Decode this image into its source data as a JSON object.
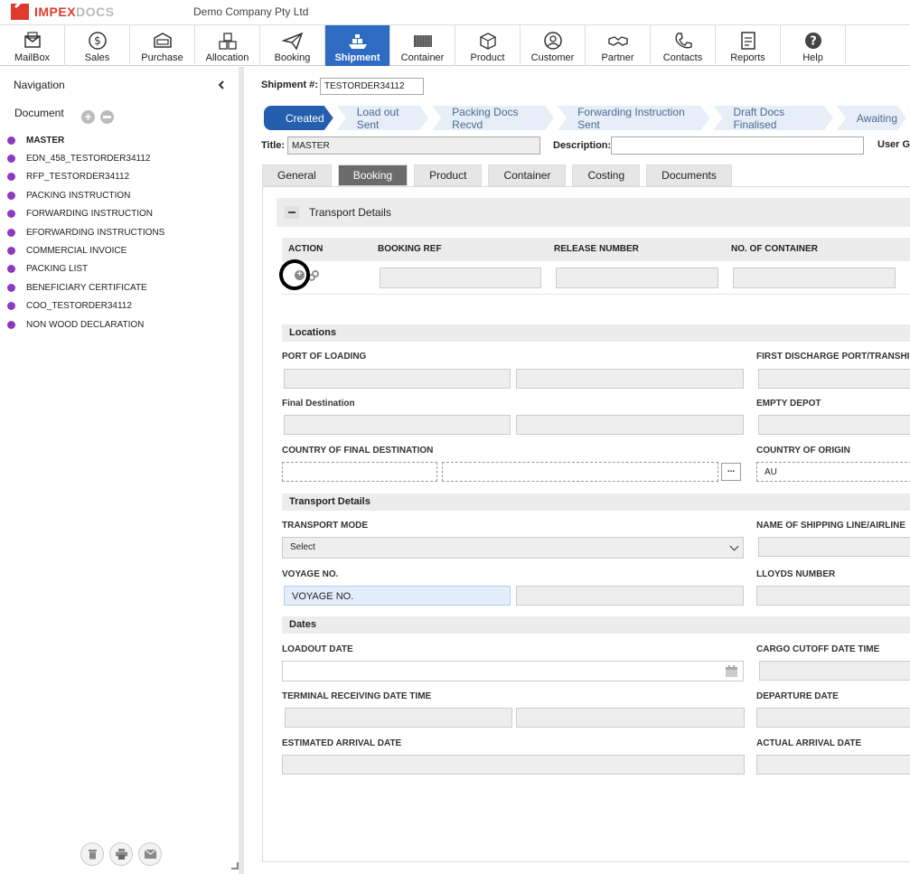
{
  "brand": {
    "part1": "IMPEX",
    "part2": "DOCS"
  },
  "company": "Demo Company Pty Ltd",
  "toolbar": [
    {
      "label": "MailBox",
      "icon": "mailbox-icon"
    },
    {
      "label": "Sales",
      "icon": "dollar-icon"
    },
    {
      "label": "Purchase",
      "icon": "cart-icon"
    },
    {
      "label": "Allocation",
      "icon": "boxes-icon"
    },
    {
      "label": "Booking",
      "icon": "paper-plane-icon"
    },
    {
      "label": "Shipment",
      "icon": "ship-icon",
      "active": true
    },
    {
      "label": "Container",
      "icon": "container-icon"
    },
    {
      "label": "Product",
      "icon": "package-icon"
    },
    {
      "label": "Customer",
      "icon": "user-icon"
    },
    {
      "label": "Partner",
      "icon": "handshake-icon"
    },
    {
      "label": "Contacts",
      "icon": "phone-icon"
    },
    {
      "label": "Reports",
      "icon": "report-icon"
    },
    {
      "label": "Help",
      "icon": "help-icon"
    }
  ],
  "sidebar": {
    "nav_title": "Navigation",
    "doc_title": "Document",
    "documents": [
      {
        "label": "MASTER",
        "bold": true
      },
      {
        "label": "EDN_458_TESTORDER34112"
      },
      {
        "label": "RFP_TESTORDER34112"
      },
      {
        "label": "PACKING INSTRUCTION"
      },
      {
        "label": "FORWARDING INSTRUCTION"
      },
      {
        "label": "EFORWARDING INSTRUCTIONS"
      },
      {
        "label": "COMMERCIAL INVOICE"
      },
      {
        "label": "PACKING LIST"
      },
      {
        "label": "BENEFICIARY CERTIFICATE"
      },
      {
        "label": "COO_TESTORDER34112"
      },
      {
        "label": "NON WOOD DECLARATION"
      }
    ]
  },
  "shipment": {
    "label": "Shipment #:",
    "value": "TESTORDER34112"
  },
  "steps": [
    {
      "label": "Created",
      "active": true
    },
    {
      "label": "Load out Sent"
    },
    {
      "label": "Packing Docs Recvd"
    },
    {
      "label": "Forwarding Instruction Sent"
    },
    {
      "label": "Draft Docs Finalised"
    },
    {
      "label": "Awaiting"
    }
  ],
  "header": {
    "title_label": "Title:",
    "title_value": "MASTER",
    "description_label": "Description:",
    "user_group_label": "User Gr"
  },
  "tabs": [
    {
      "label": "General"
    },
    {
      "label": "Booking",
      "active": true
    },
    {
      "label": "Product"
    },
    {
      "label": "Container"
    },
    {
      "label": "Costing"
    },
    {
      "label": "Documents"
    }
  ],
  "transport_section": {
    "title": "Transport Details",
    "columns": [
      "ACTION",
      "BOOKING REF",
      "RELEASE NUMBER",
      "NO. OF CONTAINER"
    ]
  },
  "locations": {
    "heading": "Locations",
    "port_of_loading": "PORT OF LOADING",
    "first_discharge": "FIRST DISCHARGE PORT/TRANSHIPMENT",
    "final_destination": "Final Destination",
    "empty_depot": "EMPTY DEPOT",
    "country_final_dest": "COUNTRY OF FINAL DESTINATION",
    "country_origin": "COUNTRY OF ORIGIN",
    "country_origin_value": "AU",
    "lookup_label": "..."
  },
  "transport": {
    "heading": "Transport Details",
    "mode_label": "TRANSPORT MODE",
    "mode_value": "Select",
    "shipping_line_label": "NAME OF SHIPPING LINE/AIRLINE",
    "voyage_label": "VOYAGE NO.",
    "voyage_placeholder": "VOYAGE NO.",
    "lloyds_label": "LLOYDS NUMBER"
  },
  "dates": {
    "heading": "Dates",
    "loadout": "LOADOUT DATE",
    "cargo_cutoff": "CARGO CUTOFF DATE TIME",
    "terminal_receiving": "TERMINAL RECEIVING DATE TIME",
    "departure": "DEPARTURE DATE",
    "eta": "ESTIMATED ARRIVAL DATE",
    "ata": "ACTUAL ARRIVAL DATE"
  },
  "colors": {
    "accent": "#235fae",
    "brand": "#e03a2e",
    "doc_dot": "#8c3bbf"
  }
}
